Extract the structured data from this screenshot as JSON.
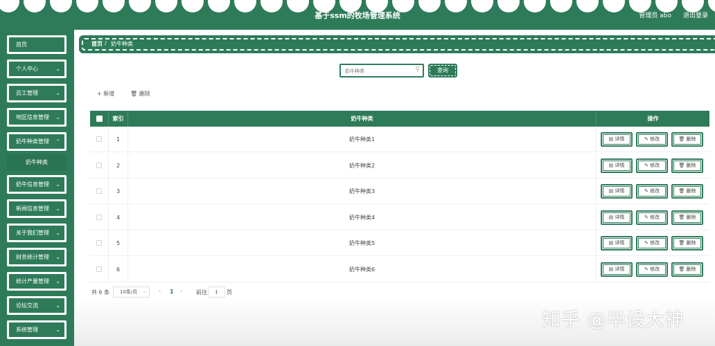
{
  "header": {
    "title": "基于ssm的牧场管理系统",
    "user": "管理员 abo",
    "logout": "退出登录"
  },
  "sidebar": {
    "items": [
      {
        "label": "首页"
      },
      {
        "label": "个人中心"
      },
      {
        "label": "员工管理"
      },
      {
        "label": "地区信息管理"
      },
      {
        "label": "奶牛种类管理"
      },
      {
        "label": "奶牛信息管理"
      },
      {
        "label": "新闻信息管理"
      },
      {
        "label": "关于我们管理"
      },
      {
        "label": "财务统计管理"
      },
      {
        "label": "统计产量管理"
      },
      {
        "label": "论坛交流"
      },
      {
        "label": "系统管理"
      }
    ],
    "subitem": "奶牛种类"
  },
  "breadcrumb": {
    "home": "首页",
    "separator": "/",
    "current": "奶牛种类"
  },
  "search": {
    "placeholder": "奶牛种类",
    "button": "查询"
  },
  "toolbar": {
    "add": "+ 新增",
    "delete": "删除"
  },
  "table": {
    "headers": {
      "index": "索引",
      "type": "奶牛种类",
      "actions": "操作"
    },
    "rows": [
      {
        "index": "1",
        "type": "奶牛种类1"
      },
      {
        "index": "2",
        "type": "奶牛种类2"
      },
      {
        "index": "3",
        "type": "奶牛种类3"
      },
      {
        "index": "4",
        "type": "奶牛种类4"
      },
      {
        "index": "5",
        "type": "奶牛种类5"
      },
      {
        "index": "6",
        "type": "奶牛种类6"
      }
    ],
    "actions": {
      "detail": "详情",
      "edit": "修改",
      "delete": "删除"
    }
  },
  "pagination": {
    "total": "共 6 条",
    "page_size": "10条/页",
    "current_page": "1",
    "goto_label": "前往",
    "goto_value": "1",
    "page_suffix": "页"
  },
  "watermark": "知乎 @毕设大神",
  "colors": {
    "primary": "#2e7b5a",
    "background": "#ffffff"
  }
}
